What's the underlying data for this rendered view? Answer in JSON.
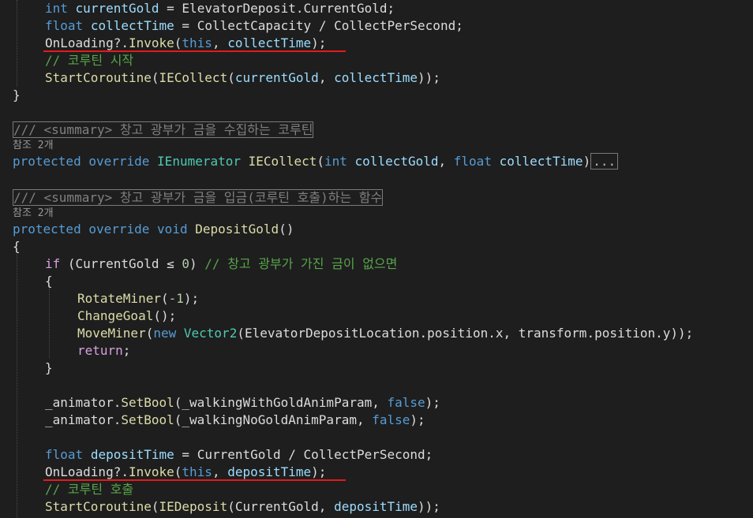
{
  "code": {
    "l1": {
      "type": "int",
      "name": "currentGold",
      "op": " = ",
      "expr": "ElevatorDeposit.CurrentGold;"
    },
    "l2": {
      "type": "float",
      "name": "collectTime",
      "op": " = ",
      "expr": "CollectCapacity / CollectPerSecond;"
    },
    "l3": {
      "call": "OnLoading",
      "op": "?.",
      "method": "Invoke",
      "open": "(",
      "this": "this",
      "sep": ", ",
      "arg": "collectTime",
      "close": ");"
    },
    "l4": {
      "comment": "// 코루틴 시작"
    },
    "l5": {
      "method": "StartCoroutine",
      "open1": "(",
      "inner": "IECollect",
      "open2": "(",
      "arg1": "currentGold",
      "sep": ", ",
      "arg2": "collectTime",
      "close": "));"
    },
    "l6": {
      "brace": "}"
    },
    "doc1": {
      "text": "/// <summary> 창고 광부가 금을 수집하는 코루틴"
    },
    "refs1": "참조 2개",
    "sig1": {
      "kw1": "protected",
      "kw2": "override",
      "type": "IEnumerator",
      "name": "IECollect",
      "open": "(",
      "ptype1": "int",
      "p1": "collectGold",
      "sep": ", ",
      "ptype2": "float",
      "p2": "collectTime",
      "close": ")",
      "collapsed": "..."
    },
    "doc2": {
      "text": "/// <summary> 창고 광부가 금을 입금(코루틴 호출)하는 함수"
    },
    "refs2": "참조 2개",
    "sig2": {
      "kw1": "protected",
      "kw2": "override",
      "kw3": "void",
      "name": "DepositGold",
      "parens": "()"
    },
    "l7": {
      "brace": "{"
    },
    "l8": {
      "kw": "if",
      "cond": " (CurrentGold ≤ ",
      "num": "0",
      "close": ") ",
      "comment": "// 창고 광부가 가진 금이 없으면"
    },
    "l9": {
      "brace": "{"
    },
    "l10": {
      "method": "RotateMiner",
      "open": "(",
      "num": "-1",
      "close": ");"
    },
    "l11": {
      "method": "ChangeGoal",
      "rest": "();"
    },
    "l12": {
      "method": "MoveMiner",
      "open": "(",
      "kw": "new",
      "type": "Vector2",
      "rest": "(ElevatorDepositLocation.position.x, transform.position.y));"
    },
    "l13": {
      "kw": "return",
      "rest": ";"
    },
    "l14": {
      "brace": "}"
    },
    "l15": {
      "obj": "_animator.",
      "method": "SetBool",
      "open": "(",
      "param": "_walkingWithGoldAnimParam",
      "sep": ", ",
      "val": "false",
      "close": ");"
    },
    "l16": {
      "obj": "_animator.",
      "method": "SetBool",
      "open": "(",
      "param": "_walkingNoGoldAnimParam",
      "sep": ", ",
      "val": "false",
      "close": ");"
    },
    "l17": {
      "type": "float",
      "name": "depositTime",
      "op": " = ",
      "expr": "CurrentGold / CollectPerSecond;"
    },
    "l18": {
      "call": "OnLoading",
      "op": "?.",
      "method": "Invoke",
      "open": "(",
      "this": "this",
      "sep": ", ",
      "arg": "depositTime",
      "close": ");"
    },
    "l19": {
      "comment": "// 코루틴 호출"
    },
    "l20": {
      "method": "StartCoroutine",
      "open1": "(",
      "inner": "IEDeposit",
      "open2": "(CurrentGold, ",
      "arg": "depositTime",
      "close": "));"
    }
  },
  "colors": {
    "background": "#1e1e1e",
    "keyword": "#569cd6",
    "control": "#d8a0df",
    "method": "#dcdcaa",
    "type": "#4ec9b0",
    "variable": "#9cdcfe",
    "comment": "#57a64a",
    "highlight_underline": "#e31b1b"
  }
}
